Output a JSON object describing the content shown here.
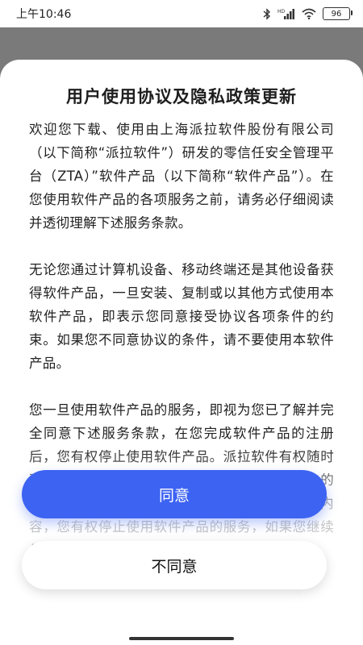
{
  "status_bar": {
    "time": "上午10:46",
    "battery": "96",
    "icons": [
      "bluetooth-icon",
      "signal-icon",
      "wifi-icon",
      "battery-icon"
    ],
    "network_label": "HD"
  },
  "dialog": {
    "title": "用户使用协议及隐私政策更新",
    "paragraphs": [
      "欢迎您下载、使用由上海派拉软件股份有限公司（以下简称“派拉软件”）研发的零信任安全管理平台（ZTA）”软件产品（以下简称“软件产品”）。在您使用软件产品的各项服务之前，请务必仔细阅读并透彻理解下述服务条款。",
      "无论您通过计算机设备、移动终端还是其他设备获得软件产品，一旦安装、复制或以其他方式使用本软件产品，即表示您同意接受协议各项条件的约束。如果您不同意协议的条件，请不要使用本软件产品。",
      "您一旦使用软件产品的服务，即视为您已了解并完全同意下述服务条款，在您完成软件产品的注册后，您有权停止使用软件产品。派拉软件有权随时更新服务条款，条款一旦发生变动，将会以公告的形式通知您，如果您不同意更新后的服务条款内容，您有权停止使用软件产品的服务，如果您继续使用相关服务，则视为接受服务条款的变"
    ],
    "agree_label": "同意",
    "disagree_label": "不同意"
  },
  "colors": {
    "accent": "#3d63f2",
    "overlay": "#7a7a7a"
  }
}
